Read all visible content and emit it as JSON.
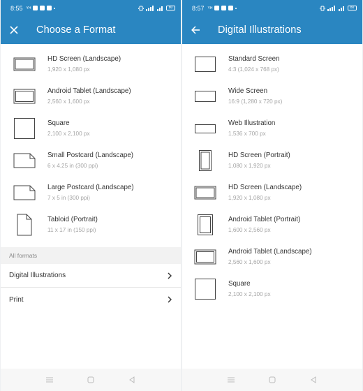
{
  "colors": {
    "accent": "#2a86c1",
    "text": "#333333",
    "secondary": "#a5a5a5"
  },
  "left": {
    "status": {
      "time": "8:55",
      "tiny": "YH",
      "battery": "80"
    },
    "header": {
      "title": "Choose a Format",
      "nav_icon": "close-icon"
    },
    "formats": [
      {
        "name": "HD Screen (Landscape)",
        "dims": "1,920 x 1,080 px",
        "icon": "landscape-screen-icon"
      },
      {
        "name": "Android Tablet (Landscape)",
        "dims": "2,560 x 1,600 px",
        "icon": "landscape-tablet-icon"
      },
      {
        "name": "Square",
        "dims": "2,100 x 2,100 px",
        "icon": "square-icon"
      },
      {
        "name": "Small Postcard (Landscape)",
        "dims": "6 x 4.25 in (300 ppi)",
        "icon": "postcard-icon"
      },
      {
        "name": "Large Postcard (Landscape)",
        "dims": "7 x 5 in (300 ppi)",
        "icon": "postcard-icon"
      },
      {
        "name": "Tabloid (Portrait)",
        "dims": "11 x 17 in (150 ppi)",
        "icon": "portrait-page-icon"
      }
    ],
    "all_formats_label": "All formats",
    "categories": [
      {
        "label": "Digital Illustrations"
      },
      {
        "label": "Print"
      }
    ]
  },
  "right": {
    "status": {
      "time": "8:57",
      "tiny": "YH",
      "battery": "80"
    },
    "header": {
      "title": "Digital Illustrations",
      "nav_icon": "back-arrow-icon"
    },
    "formats": [
      {
        "name": "Standard Screen",
        "dims": "4:3 (1,024 x 768 px)",
        "icon": "standard-screen-icon"
      },
      {
        "name": "Wide Screen",
        "dims": "16:9 (1,280 x 720 px)",
        "icon": "wide-screen-icon"
      },
      {
        "name": "Web Illustration",
        "dims": "1,536 x 700 px",
        "icon": "web-illustration-icon"
      },
      {
        "name": "HD Screen (Portrait)",
        "dims": "1,080 x 1,920 px",
        "icon": "portrait-screen-icon"
      },
      {
        "name": "HD Screen (Landscape)",
        "dims": "1,920 x 1,080 px",
        "icon": "landscape-screen-icon"
      },
      {
        "name": "Android Tablet (Portrait)",
        "dims": "1,600 x 2,560 px",
        "icon": "portrait-tablet-icon"
      },
      {
        "name": "Android Tablet (Landscape)",
        "dims": "2,560 x 1,600 px",
        "icon": "landscape-tablet-icon"
      },
      {
        "name": "Square",
        "dims": "2,100 x 2,100 px",
        "icon": "square-icon"
      }
    ]
  }
}
